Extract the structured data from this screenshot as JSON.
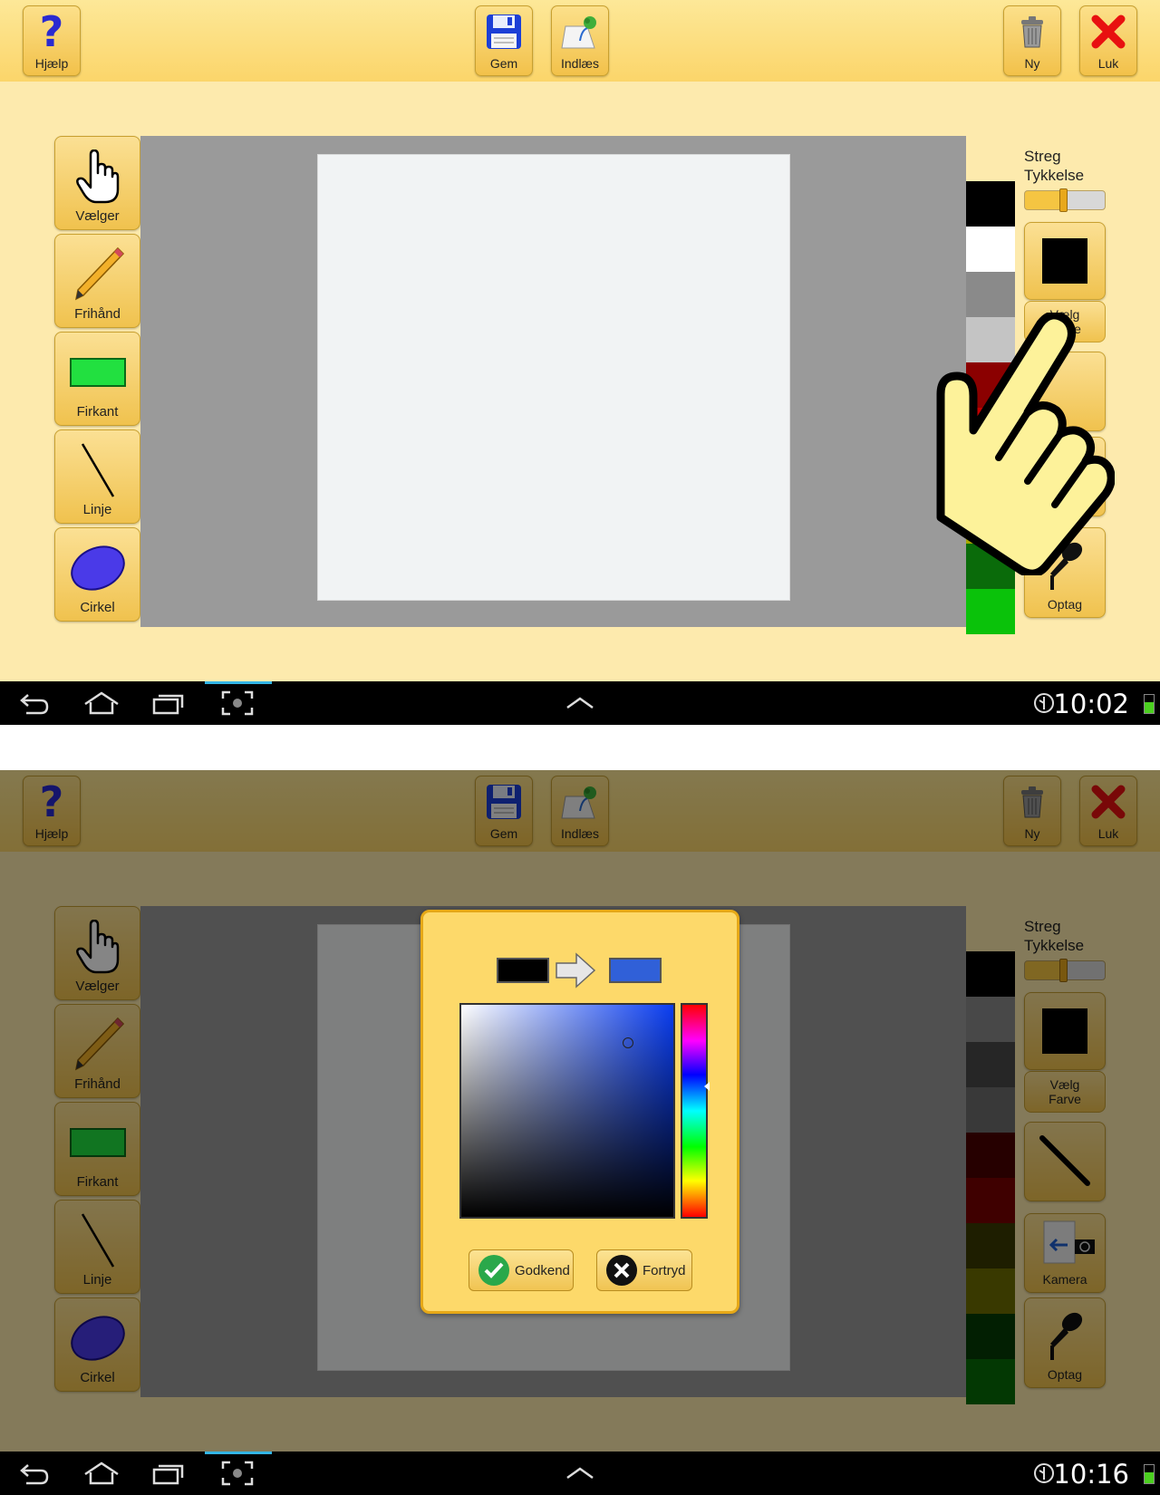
{
  "toolbar": {
    "help_label": "Hjælp",
    "save_label": "Gem",
    "load_label": "Indlæs",
    "new_label": "Ny",
    "close_label": "Luk"
  },
  "tools": {
    "selector_label": "Vælger",
    "freehand_label": "Frihånd",
    "rectangle_label": "Firkant",
    "line_label": "Linje",
    "circle_label": "Cirkel"
  },
  "side_panel": {
    "stroke_title_line1": "Streg",
    "stroke_title_line2": "Tykkelse",
    "choose_color_line1": "Vælg",
    "choose_color_line2": "Farve",
    "camera_label": "Kamera",
    "record_label": "Optag"
  },
  "screen1": {
    "clock": "10:02",
    "palette": [
      "#000000",
      "#ffffff",
      "#8a8a8a",
      "#c4c4c4",
      "#8b0000",
      "#c00000",
      "#6b6b00",
      "#a8a800",
      "#0a6b0a",
      "#0ac20a"
    ]
  },
  "screen2": {
    "clock": "10:16",
    "palette": [
      "#000000",
      "#8a8a8a",
      "#4a4a4a",
      "#6e6e6e",
      "#4a0000",
      "#7a0000",
      "#3a3a00",
      "#6e6e00",
      "#043d04",
      "#066b06"
    ]
  },
  "color_dialog": {
    "old_color": "#000000",
    "new_color": "#3060d8",
    "accept_label": "Godkend",
    "cancel_label": "Fortryd"
  },
  "colors": {
    "topbar": "#fbd56a",
    "app_background": "#fdeaad",
    "button_gold": "#f0c24e",
    "canvas_gray": "#9a9a9a"
  },
  "icons": [
    "help-icon",
    "save-icon",
    "load-icon",
    "trash-icon",
    "close-icon",
    "hand-pointer-icon",
    "pencil-icon",
    "rectangle-icon",
    "line-icon",
    "ellipse-icon",
    "microphone-icon",
    "camera-icon",
    "back-icon",
    "home-icon",
    "recent-apps-icon",
    "screenshot-icon",
    "chevron-up-icon",
    "battery-icon"
  ]
}
